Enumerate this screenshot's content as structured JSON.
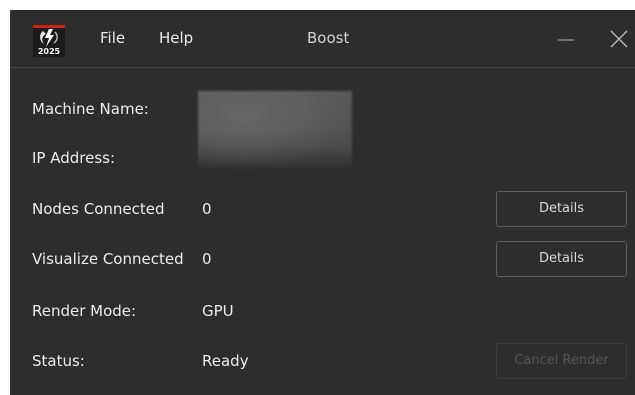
{
  "titlebar": {
    "icon_year": "2025",
    "menu": [
      {
        "label": "File"
      },
      {
        "label": "Help"
      }
    ],
    "title": "Boost"
  },
  "fields": {
    "machine_name": {
      "label": "Machine Name:",
      "value": ""
    },
    "ip_address": {
      "label": "IP Address:",
      "value": ""
    },
    "nodes_connected": {
      "label": "Nodes Connected",
      "value": "0"
    },
    "visualize_connected": {
      "label": "Visualize Connected",
      "value": "0"
    },
    "render_mode": {
      "label": "Render Mode:",
      "value": "GPU"
    },
    "status": {
      "label": "Status:",
      "value": "Ready"
    }
  },
  "buttons": {
    "nodes_details": "Details",
    "visualize_details": "Details",
    "cancel_render": "Cancel Render"
  },
  "colors": {
    "window_bg": "#2d2d2d",
    "accent_red": "#c8241c",
    "text": "#ededed"
  }
}
